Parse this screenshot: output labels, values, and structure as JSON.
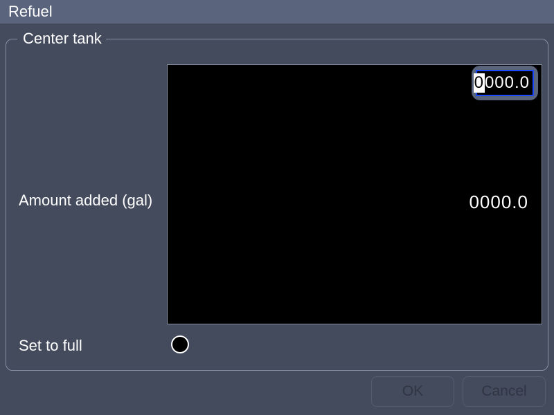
{
  "window": {
    "title": "Refuel"
  },
  "panel": {
    "legend": "Center tank",
    "amount_label": "Amount added (gal)",
    "amount_value": "0000.0",
    "input_value_rest": "000.0",
    "input_value_highlight": "0",
    "set_full_label": "Set to full",
    "set_full_checked": false
  },
  "buttons": {
    "ok": "OK",
    "cancel": "Cancel"
  }
}
